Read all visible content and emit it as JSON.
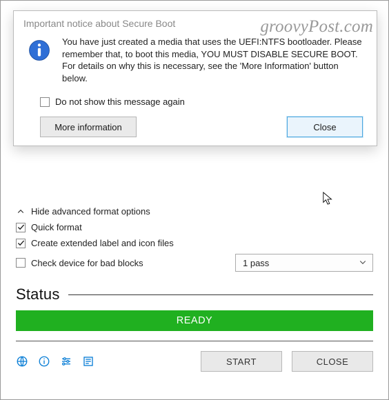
{
  "dialog": {
    "title": "Important notice about Secure Boot",
    "body_line1": "You have just created a media that uses the UEFI:NTFS bootloader. Please remember that, to boot this media, YOU MUST DISABLE SECURE BOOT.",
    "body_line2": "For details on why this is necessary, see the 'More Information' button below.",
    "dont_show_label": "Do not show this message again",
    "dont_show_checked": false,
    "more_info_label": "More information",
    "close_label": "Close"
  },
  "advanced": {
    "header": "Hide advanced format options",
    "quick_format": {
      "label": "Quick format",
      "checked": true
    },
    "ext_label": {
      "label": "Create extended label and icon files",
      "checked": true
    },
    "bad_blocks": {
      "label": "Check device for bad blocks",
      "checked": false
    },
    "pass_select": {
      "selected": "1 pass"
    }
  },
  "status": {
    "title": "Status",
    "state": "READY"
  },
  "buttons": {
    "start": "START",
    "close": "CLOSE"
  },
  "icons": {
    "info": "info-icon",
    "chevron_up": "chevron-up-icon",
    "check": "✓",
    "globe": "globe-icon",
    "about": "info-small-icon",
    "settings": "sliders-icon",
    "log": "log-icon"
  },
  "watermark": "groovyPost.com"
}
